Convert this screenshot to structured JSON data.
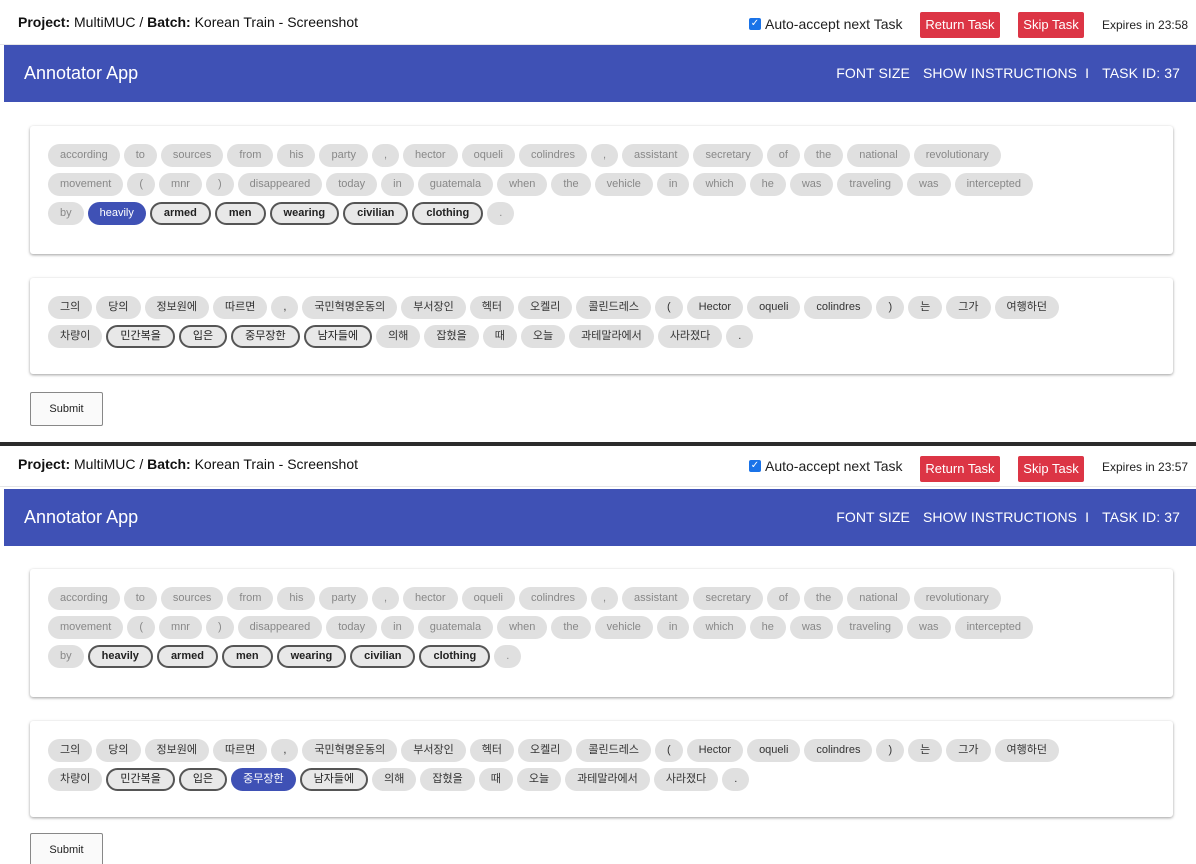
{
  "frames": [
    {
      "project_label": "Project:",
      "project_name": "MultiMUC",
      "batch_label": "Batch:",
      "batch_name": "Korean Train - Screenshot",
      "auto_accept_label": "Auto-accept next Task",
      "auto_accept_checked": true,
      "return_label": "Return Task",
      "skip_label": "Skip Task",
      "expires": "Expires in 23:58",
      "app_title": "Annotator App",
      "font_size_label": "FONT SIZE",
      "instructions_label": "SHOW INSTRUCTIONS",
      "separator": "I",
      "task_id": "TASK ID: 37",
      "submit_label": "Submit",
      "en_tokens": [
        {
          "t": "according",
          "s": "normal"
        },
        {
          "t": "to",
          "s": "normal"
        },
        {
          "t": "sources",
          "s": "normal"
        },
        {
          "t": "from",
          "s": "normal"
        },
        {
          "t": "his",
          "s": "normal"
        },
        {
          "t": "party",
          "s": "normal"
        },
        {
          "t": ",",
          "s": "normal"
        },
        {
          "t": "hector",
          "s": "normal"
        },
        {
          "t": "oqueli",
          "s": "normal"
        },
        {
          "t": "colindres",
          "s": "normal"
        },
        {
          "t": ",",
          "s": "normal"
        },
        {
          "t": "assistant",
          "s": "normal"
        },
        {
          "t": "secretary",
          "s": "normal"
        },
        {
          "t": "of",
          "s": "normal"
        },
        {
          "t": "the",
          "s": "normal"
        },
        {
          "t": "national",
          "s": "normal"
        },
        {
          "t": "revolutionary",
          "s": "normal"
        },
        {
          "t": "movement",
          "s": "normal"
        },
        {
          "t": "(",
          "s": "normal"
        },
        {
          "t": "mnr",
          "s": "normal"
        },
        {
          "t": ")",
          "s": "normal"
        },
        {
          "t": "disappeared",
          "s": "normal"
        },
        {
          "t": "today",
          "s": "normal"
        },
        {
          "t": "in",
          "s": "normal"
        },
        {
          "t": "guatemala",
          "s": "normal"
        },
        {
          "t": "when",
          "s": "normal"
        },
        {
          "t": "the",
          "s": "normal"
        },
        {
          "t": "vehicle",
          "s": "normal"
        },
        {
          "t": "in",
          "s": "normal"
        },
        {
          "t": "which",
          "s": "normal"
        },
        {
          "t": "he",
          "s": "normal"
        },
        {
          "t": "was",
          "s": "normal"
        },
        {
          "t": "traveling",
          "s": "normal"
        },
        {
          "t": "was",
          "s": "normal"
        },
        {
          "t": "intercepted",
          "s": "normal"
        },
        {
          "t": "by",
          "s": "normal"
        },
        {
          "t": "heavily",
          "s": "sel"
        },
        {
          "t": "armed",
          "s": "cand"
        },
        {
          "t": "men",
          "s": "cand"
        },
        {
          "t": "wearing",
          "s": "cand"
        },
        {
          "t": "civilian",
          "s": "cand"
        },
        {
          "t": "clothing",
          "s": "cand"
        },
        {
          "t": ".",
          "s": "normal"
        }
      ],
      "ko_tokens": [
        {
          "t": "그의",
          "s": "normal"
        },
        {
          "t": "당의",
          "s": "normal"
        },
        {
          "t": "정보원에",
          "s": "normal"
        },
        {
          "t": "따르면",
          "s": "normal"
        },
        {
          "t": ",",
          "s": "normal"
        },
        {
          "t": "국민혁명운동의",
          "s": "normal"
        },
        {
          "t": "부서장인",
          "s": "normal"
        },
        {
          "t": "헥터",
          "s": "normal"
        },
        {
          "t": "오켈리",
          "s": "normal"
        },
        {
          "t": "콜린드레스",
          "s": "normal"
        },
        {
          "t": "(",
          "s": "normal"
        },
        {
          "t": "Hector",
          "s": "normal"
        },
        {
          "t": "oqueli",
          "s": "normal"
        },
        {
          "t": "colindres",
          "s": "normal"
        },
        {
          "t": ")",
          "s": "normal"
        },
        {
          "t": "는",
          "s": "normal"
        },
        {
          "t": "그가",
          "s": "normal"
        },
        {
          "t": "여행하던",
          "s": "normal"
        },
        {
          "t": "차량이",
          "s": "normal"
        },
        {
          "t": "민간복을",
          "s": "cand"
        },
        {
          "t": "입은",
          "s": "cand"
        },
        {
          "t": "중무장한",
          "s": "cand"
        },
        {
          "t": "남자들에",
          "s": "cand"
        },
        {
          "t": "의해",
          "s": "normal"
        },
        {
          "t": "잡혔을",
          "s": "normal"
        },
        {
          "t": "때",
          "s": "normal"
        },
        {
          "t": "오늘",
          "s": "normal"
        },
        {
          "t": "과테말라에서",
          "s": "normal"
        },
        {
          "t": "사라졌다",
          "s": "normal"
        },
        {
          "t": ".",
          "s": "normal"
        }
      ]
    },
    {
      "project_label": "Project:",
      "project_name": "MultiMUC",
      "batch_label": "Batch:",
      "batch_name": "Korean Train - Screenshot",
      "auto_accept_label": "Auto-accept next Task",
      "auto_accept_checked": true,
      "return_label": "Return Task",
      "skip_label": "Skip Task",
      "expires": "Expires in 23:57",
      "app_title": "Annotator App",
      "font_size_label": "FONT SIZE",
      "instructions_label": "SHOW INSTRUCTIONS",
      "separator": "I",
      "task_id": "TASK ID: 37",
      "submit_label": "Submit",
      "en_tokens": [
        {
          "t": "according",
          "s": "normal"
        },
        {
          "t": "to",
          "s": "normal"
        },
        {
          "t": "sources",
          "s": "normal"
        },
        {
          "t": "from",
          "s": "normal"
        },
        {
          "t": "his",
          "s": "normal"
        },
        {
          "t": "party",
          "s": "normal"
        },
        {
          "t": ",",
          "s": "normal"
        },
        {
          "t": "hector",
          "s": "normal"
        },
        {
          "t": "oqueli",
          "s": "normal"
        },
        {
          "t": "colindres",
          "s": "normal"
        },
        {
          "t": ",",
          "s": "normal"
        },
        {
          "t": "assistant",
          "s": "normal"
        },
        {
          "t": "secretary",
          "s": "normal"
        },
        {
          "t": "of",
          "s": "normal"
        },
        {
          "t": "the",
          "s": "normal"
        },
        {
          "t": "national",
          "s": "normal"
        },
        {
          "t": "revolutionary",
          "s": "normal"
        },
        {
          "t": "movement",
          "s": "normal"
        },
        {
          "t": "(",
          "s": "normal"
        },
        {
          "t": "mnr",
          "s": "normal"
        },
        {
          "t": ")",
          "s": "normal"
        },
        {
          "t": "disappeared",
          "s": "normal"
        },
        {
          "t": "today",
          "s": "normal"
        },
        {
          "t": "in",
          "s": "normal"
        },
        {
          "t": "guatemala",
          "s": "normal"
        },
        {
          "t": "when",
          "s": "normal"
        },
        {
          "t": "the",
          "s": "normal"
        },
        {
          "t": "vehicle",
          "s": "normal"
        },
        {
          "t": "in",
          "s": "normal"
        },
        {
          "t": "which",
          "s": "normal"
        },
        {
          "t": "he",
          "s": "normal"
        },
        {
          "t": "was",
          "s": "normal"
        },
        {
          "t": "traveling",
          "s": "normal"
        },
        {
          "t": "was",
          "s": "normal"
        },
        {
          "t": "intercepted",
          "s": "normal"
        },
        {
          "t": "by",
          "s": "normal"
        },
        {
          "t": "heavily",
          "s": "sel-cand"
        },
        {
          "t": "armed",
          "s": "cand"
        },
        {
          "t": "men",
          "s": "cand"
        },
        {
          "t": "wearing",
          "s": "cand"
        },
        {
          "t": "civilian",
          "s": "cand"
        },
        {
          "t": "clothing",
          "s": "cand"
        },
        {
          "t": ".",
          "s": "normal"
        }
      ],
      "ko_tokens": [
        {
          "t": "그의",
          "s": "normal"
        },
        {
          "t": "당의",
          "s": "normal"
        },
        {
          "t": "정보원에",
          "s": "normal"
        },
        {
          "t": "따르면",
          "s": "normal"
        },
        {
          "t": ",",
          "s": "normal"
        },
        {
          "t": "국민혁명운동의",
          "s": "normal"
        },
        {
          "t": "부서장인",
          "s": "normal"
        },
        {
          "t": "헥터",
          "s": "normal"
        },
        {
          "t": "오켈리",
          "s": "normal"
        },
        {
          "t": "콜린드레스",
          "s": "normal"
        },
        {
          "t": "(",
          "s": "normal"
        },
        {
          "t": "Hector",
          "s": "normal"
        },
        {
          "t": "oqueli",
          "s": "normal"
        },
        {
          "t": "colindres",
          "s": "normal"
        },
        {
          "t": ")",
          "s": "normal"
        },
        {
          "t": "는",
          "s": "normal"
        },
        {
          "t": "그가",
          "s": "normal"
        },
        {
          "t": "여행하던",
          "s": "normal"
        },
        {
          "t": "차량이",
          "s": "normal"
        },
        {
          "t": "민간복을",
          "s": "cand"
        },
        {
          "t": "입은",
          "s": "cand"
        },
        {
          "t": "중무장한",
          "s": "sel"
        },
        {
          "t": "남자들에",
          "s": "cand"
        },
        {
          "t": "의해",
          "s": "normal"
        },
        {
          "t": "잡혔을",
          "s": "normal"
        },
        {
          "t": "때",
          "s": "normal"
        },
        {
          "t": "오늘",
          "s": "normal"
        },
        {
          "t": "과테말라에서",
          "s": "normal"
        },
        {
          "t": "사라졌다",
          "s": "normal"
        },
        {
          "t": ".",
          "s": "normal"
        }
      ]
    }
  ],
  "colors": {
    "accent": "#3f51b5",
    "danger": "#dc3545",
    "token_bg": "#e0e0e0"
  }
}
